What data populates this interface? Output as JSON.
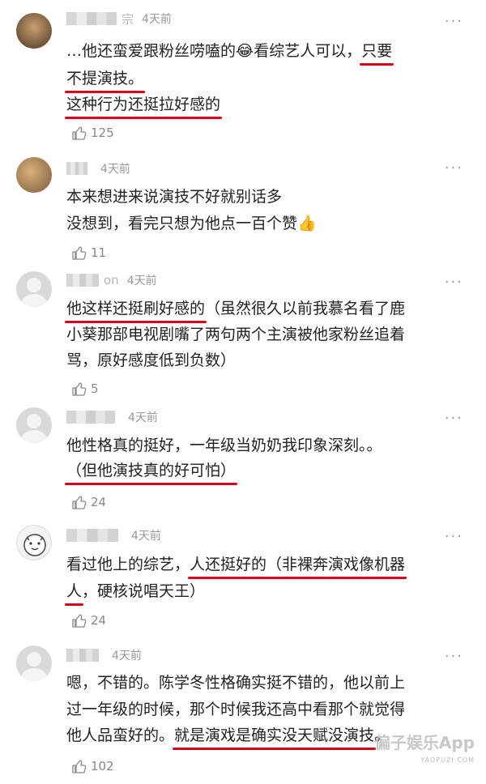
{
  "ellipsis": "···",
  "comments": [
    {
      "name_tail": "宗",
      "time": "4天前",
      "lines": [
        {
          "pre": "…他还蛮爱跟粉丝唠嗑的😂看综艺人可以，",
          "ul": "只要",
          "post": ""
        },
        {
          "pre": "",
          "ul": "不提演技。",
          "post": ""
        },
        {
          "pre": "",
          "ul": "这种行为还挺拉好感的",
          "post": ""
        }
      ],
      "likes": "125"
    },
    {
      "name_tail": "",
      "time": "4天前",
      "lines": [
        {
          "pre": "本来想进来说演技不好就别话多",
          "ul": "",
          "post": ""
        },
        {
          "pre": "没想到，看完只想为他点一百个赞👍",
          "ul": "",
          "post": ""
        }
      ],
      "likes": "11"
    },
    {
      "name_tail": "on",
      "time": "4天前",
      "lines": [
        {
          "pre": "",
          "ul": "他这样还挺刷好感的",
          "post": "（虽然很久以前我慕名看了鹿"
        },
        {
          "pre": "小葵那部电视剧嘴了两句两个主演被他家粉丝追着",
          "ul": "",
          "post": ""
        },
        {
          "pre": "骂，原好感度低到负数）",
          "ul": "",
          "post": ""
        }
      ],
      "likes": "5"
    },
    {
      "name_tail": "",
      "time": "4天前",
      "lines": [
        {
          "pre": "他性格真的挺好，一年级当奶奶我印象深刻。。",
          "ul": "",
          "post": ""
        },
        {
          "pre": "",
          "ul": "（但他演技真的好可怕）",
          "post": ""
        }
      ],
      "likes": "24"
    },
    {
      "name_tail": "",
      "time": "4天前",
      "lines": [
        {
          "pre": "看过他上的综艺，",
          "ul": "人还挺好的（非裸奔演戏像机器",
          "post": ""
        },
        {
          "pre": "",
          "ul": "人",
          "post": "，硬核说唱天王）"
        }
      ],
      "likes": "24"
    },
    {
      "name_tail": "",
      "time": "4天前",
      "lines": [
        {
          "pre": "嗯，不错的。陈学冬性格确实挺不错的，他以前上",
          "ul": "",
          "post": ""
        },
        {
          "pre": "过一年级的时候，那个时候我还高中看那个就觉得",
          "ul": "",
          "post": ""
        },
        {
          "pre": "他人品蛮好的。",
          "ul": "就是演戏是确实没天赋没演技",
          "post": "。"
        }
      ],
      "likes": "102"
    }
  ],
  "watermark": {
    "main": "偏子娱乐App",
    "sub": "YAOPUZI.COM"
  }
}
